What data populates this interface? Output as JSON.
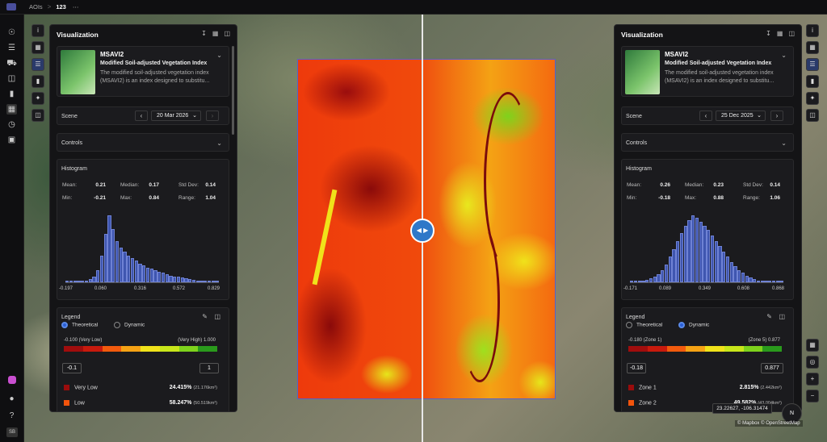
{
  "topbar": {
    "crumb_root": "AOIs",
    "separator": ">",
    "crumb_current": "123",
    "more": "⋯"
  },
  "leftnav": {
    "icons": [
      "compass-icon",
      "layers-stack-icon",
      "truck-icon",
      "cart-icon",
      "bar-chart-icon",
      "map-icon",
      "workflow-icon",
      "store-icon"
    ],
    "avatar": "SB"
  },
  "panels": {
    "left": {
      "title": "Visualization",
      "index": {
        "name": "MSAVI2",
        "full": "Modified Soil-adjusted Vegetation Index",
        "desc": "The modified soil-adjusted vegetation index (MSAVI2) is an index designed to substitu..."
      },
      "scene": {
        "label": "Scene",
        "date": "20 Mar 2026"
      },
      "controls": "Controls",
      "histogram": {
        "title": "Histogram",
        "mean_label": "Mean:",
        "mean": "0.21",
        "median_label": "Median:",
        "median": "0.17",
        "std_label": "Std Dev:",
        "std": "0.14",
        "min_label": "Min:",
        "min": "-0.21",
        "max_label": "Max:",
        "max": "0.84",
        "range_label": "Range:",
        "range": "1.04",
        "ticks": [
          "-0.197",
          "0.060",
          "0.316",
          "0.572",
          "0.829"
        ]
      },
      "legend": {
        "title": "Legend",
        "opt1": "Theoretical",
        "opt2": "Dynamic",
        "selected": "Theoretical",
        "low_label": "-0.100 (Very Low)",
        "high_label": "(Very High) 1.000",
        "min_value": "-0.1",
        "max_value": "1",
        "rows": [
          {
            "label": "Very Low",
            "pct": "24.415%",
            "area": "(21.176km²)",
            "color": "#9a0c0c"
          },
          {
            "label": "Low",
            "pct": "58.247%",
            "area": "(50.519km²)",
            "color": "#f2540c"
          }
        ]
      }
    },
    "right": {
      "title": "Visualization",
      "index": {
        "name": "MSAVI2",
        "full": "Modified Soil-adjusted Vegetation Index",
        "desc": "The modified soil-adjusted vegetation index (MSAVI2) is an index designed to substitu..."
      },
      "scene": {
        "label": "Scene",
        "date": "25 Dec 2025"
      },
      "controls": "Controls",
      "histogram": {
        "title": "Histogram",
        "mean_label": "Mean:",
        "mean": "0.26",
        "median_label": "Median:",
        "median": "0.23",
        "std_label": "Std Dev:",
        "std": "0.14",
        "min_label": "Min:",
        "min": "-0.18",
        "max_label": "Max:",
        "max": "0.88",
        "range_label": "Range:",
        "range": "1.06",
        "ticks": [
          "-0.171",
          "0.089",
          "0.349",
          "0.608",
          "0.868"
        ]
      },
      "legend": {
        "title": "Legend",
        "opt1": "Theoretical",
        "opt2": "Dynamic",
        "selected": "Dynamic",
        "low_label": "-0.180 (Zone 1)",
        "high_label": "(Zone 5) 0.877",
        "min_value": "-0.18",
        "max_value": "0.877",
        "rows": [
          {
            "label": "Zone 1",
            "pct": "2.815%",
            "area": "(2.442km²)",
            "color": "#9a0c0c"
          },
          {
            "label": "Zone 2",
            "pct": "49.582%",
            "area": "(43.004km²)",
            "color": "#f2540c"
          }
        ]
      }
    }
  },
  "ramp_colors": [
    "#a10d0d",
    "#c81a0d",
    "#f25a0d",
    "#f5a214",
    "#f0e21a",
    "#c8e61a",
    "#7ed21c",
    "#2a9a1c"
  ],
  "map": {
    "coords": "23.22627, -106.31474",
    "attribution": "© Mapbox © OpenStreetMap",
    "compass": "N"
  },
  "chart_data": [
    {
      "type": "bar",
      "title": "Histogram",
      "x_ticks": [
        "-0.197",
        "0.060",
        "0.316",
        "0.572",
        "0.829"
      ],
      "values": [
        1,
        1,
        1,
        1,
        2,
        3,
        5,
        9,
        18,
        40,
        72,
        100,
        80,
        62,
        52,
        46,
        40,
        36,
        32,
        28,
        25,
        22,
        20,
        18,
        16,
        14,
        12,
        10,
        9,
        8,
        7,
        6,
        5,
        4,
        3,
        2,
        2,
        1,
        1,
        1
      ]
    },
    {
      "type": "bar",
      "title": "Histogram",
      "x_ticks": [
        "-0.171",
        "0.089",
        "0.349",
        "0.608",
        "0.868"
      ],
      "values": [
        1,
        1,
        2,
        3,
        4,
        6,
        8,
        12,
        18,
        26,
        38,
        50,
        62,
        74,
        84,
        93,
        100,
        96,
        90,
        84,
        78,
        70,
        62,
        54,
        46,
        38,
        30,
        24,
        18,
        14,
        10,
        7,
        5,
        3,
        2,
        1,
        1,
        1,
        1,
        1
      ]
    }
  ]
}
